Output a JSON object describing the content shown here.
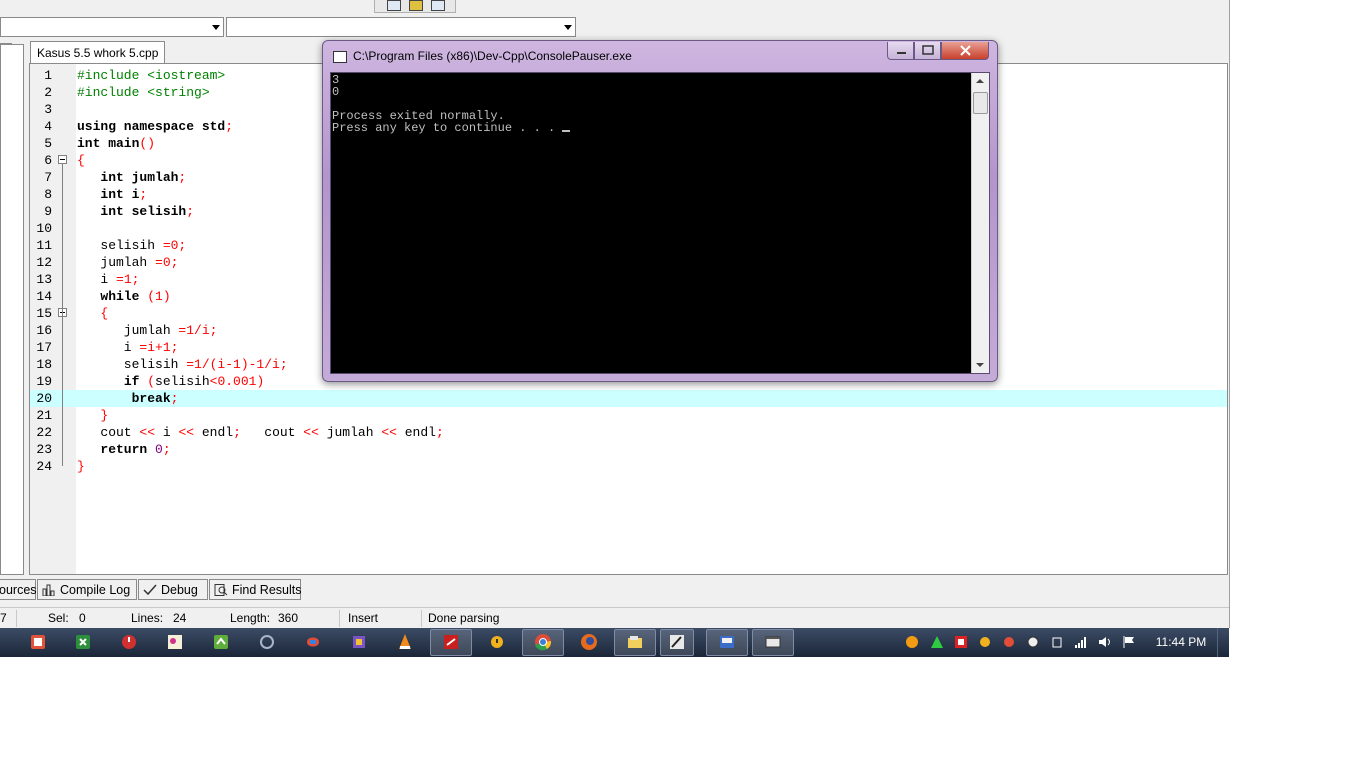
{
  "ide": {
    "left_tab_fragment": "g",
    "editor_tab": "Kasus 5.5 whork 5.cpp",
    "code_lines": [
      {
        "n": "1",
        "parts": [
          [
            "pp",
            "#include <iostream>"
          ]
        ]
      },
      {
        "n": "2",
        "parts": [
          [
            "pp",
            "#include <string>"
          ]
        ]
      },
      {
        "n": "3",
        "parts": []
      },
      {
        "n": "4",
        "parts": [
          [
            "kw",
            "using namespace std"
          ],
          [
            "sym",
            ";"
          ]
        ]
      },
      {
        "n": "5",
        "parts": [
          [
            "kw",
            "int main"
          ],
          [
            "sym",
            "()"
          ]
        ]
      },
      {
        "n": "6",
        "parts": [
          [
            "sym",
            "{"
          ]
        ]
      },
      {
        "n": "7",
        "parts": [
          [
            "txt",
            "   "
          ],
          [
            "kw",
            "int jumlah"
          ],
          [
            "sym",
            ";"
          ]
        ]
      },
      {
        "n": "8",
        "parts": [
          [
            "txt",
            "   "
          ],
          [
            "kw",
            "int i"
          ],
          [
            "sym",
            ";"
          ]
        ]
      },
      {
        "n": "9",
        "parts": [
          [
            "txt",
            "   "
          ],
          [
            "kw",
            "int selisih"
          ],
          [
            "sym",
            ";"
          ]
        ]
      },
      {
        "n": "10",
        "parts": []
      },
      {
        "n": "11",
        "parts": [
          [
            "txt",
            "   selisih "
          ],
          [
            "sym",
            "=0;"
          ]
        ]
      },
      {
        "n": "12",
        "parts": [
          [
            "txt",
            "   jumlah "
          ],
          [
            "sym",
            "=0;"
          ]
        ]
      },
      {
        "n": "13",
        "parts": [
          [
            "txt",
            "   i "
          ],
          [
            "sym",
            "=1;"
          ]
        ]
      },
      {
        "n": "14",
        "parts": [
          [
            "txt",
            "   "
          ],
          [
            "kw",
            "while"
          ],
          [
            "txt",
            " "
          ],
          [
            "sym",
            "(1)"
          ]
        ]
      },
      {
        "n": "15",
        "parts": [
          [
            "txt",
            "   "
          ],
          [
            "sym",
            "{"
          ]
        ]
      },
      {
        "n": "16",
        "parts": [
          [
            "txt",
            "      jumlah "
          ],
          [
            "sym",
            "=1/i;"
          ]
        ]
      },
      {
        "n": "17",
        "parts": [
          [
            "txt",
            "      i "
          ],
          [
            "sym",
            "=i+1;"
          ]
        ]
      },
      {
        "n": "18",
        "parts": [
          [
            "txt",
            "      selisih "
          ],
          [
            "sym",
            "=1/(i-1)-1/i;"
          ]
        ]
      },
      {
        "n": "19",
        "parts": [
          [
            "txt",
            "      "
          ],
          [
            "kw",
            "if"
          ],
          [
            "txt",
            " "
          ],
          [
            "sym",
            "("
          ],
          [
            "txt",
            "selisih"
          ],
          [
            "sym",
            "<0.001)"
          ]
        ]
      },
      {
        "n": "20",
        "parts": [
          [
            "txt",
            "       "
          ],
          [
            "kw",
            "break"
          ],
          [
            "sym",
            ";"
          ]
        ]
      },
      {
        "n": "21",
        "parts": [
          [
            "txt",
            "   "
          ],
          [
            "sym",
            "}"
          ]
        ]
      },
      {
        "n": "22",
        "parts": [
          [
            "txt",
            "   cout "
          ],
          [
            "sym",
            "<<"
          ],
          [
            "txt",
            " i "
          ],
          [
            "sym",
            "<<"
          ],
          [
            "txt",
            " endl"
          ],
          [
            "sym",
            ";"
          ],
          [
            "txt",
            "   cout "
          ],
          [
            "sym",
            "<<"
          ],
          [
            "txt",
            " jumlah "
          ],
          [
            "sym",
            "<<"
          ],
          [
            "txt",
            " endl"
          ],
          [
            "sym",
            ";"
          ]
        ]
      },
      {
        "n": "23",
        "parts": [
          [
            "txt",
            "   "
          ],
          [
            "kw",
            "return"
          ],
          [
            "txt",
            " "
          ],
          [
            "num",
            "0"
          ],
          [
            "sym",
            ";"
          ]
        ]
      },
      {
        "n": "24",
        "parts": [
          [
            "sym",
            "}"
          ]
        ]
      }
    ],
    "highlight_line": "20",
    "bottom_tabs": {
      "resources": "ources",
      "compile_log": "Compile Log",
      "debug": "Debug",
      "find_results": "Find Results"
    },
    "status": {
      "col_fragment": "7",
      "sel_label": "Sel:",
      "sel_value": "0",
      "lines_label": "Lines:",
      "lines_value": "24",
      "length_label": "Length:",
      "length_value": "360",
      "mode": "Insert",
      "parse_status": "Done parsing"
    }
  },
  "console": {
    "title": "C:\\Program Files (x86)\\Dev-Cpp\\ConsolePauser.exe",
    "output": "3\n0\n\nProcess exited normally.\nPress any key to continue . . . "
  },
  "taskbar": {
    "clock": "11:44 PM"
  }
}
